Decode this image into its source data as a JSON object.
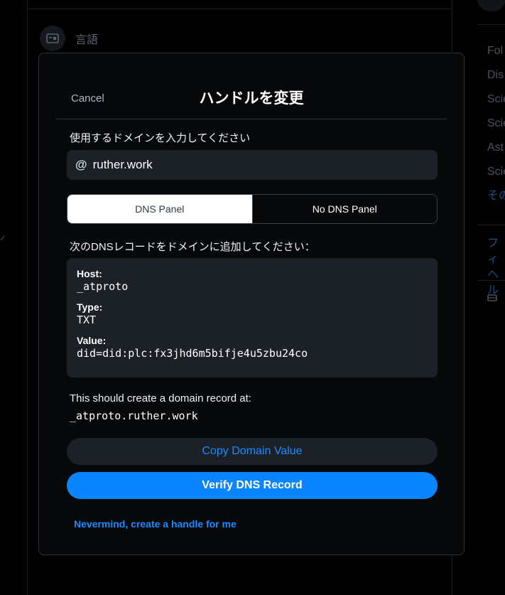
{
  "background": {
    "language_label": "言語",
    "right_items": [
      "Fol",
      "Dis",
      "Scie",
      "Scie",
      "Ast",
      "Scie"
    ],
    "right_more": "その",
    "right_blue_lines": [
      "フィ",
      "ヘル"
    ]
  },
  "modal": {
    "cancel_label": "Cancel",
    "title": "ハンドルを変更",
    "domain_prompt": "使用するドメインを入力してください",
    "domain_prefix": "@",
    "domain_value": "ruther.work",
    "tabs": [
      {
        "label": "DNS Panel",
        "active": true
      },
      {
        "label": "No DNS Panel",
        "active": false
      }
    ],
    "dns_instruction": "次のDNSレコードをドメインに追加してください：",
    "record": {
      "host_label": "Host:",
      "host_value": "_atproto",
      "type_label": "Type:",
      "type_value": "TXT",
      "value_label": "Value:",
      "value_value": "did=did:plc:fx3jhd6m5bifje4u5zbu24co"
    },
    "result_text": "This should create a domain record at:",
    "result_value": "_atproto.ruther.work",
    "copy_button": "Copy Domain Value",
    "verify_button": "Verify DNS Record",
    "nevermind_link": "Nevermind, create a handle for me"
  },
  "colors": {
    "accent": "#0a85ff",
    "link": "#1a8cff",
    "modal_bg": "#07080a",
    "field_bg": "#1c2027"
  }
}
